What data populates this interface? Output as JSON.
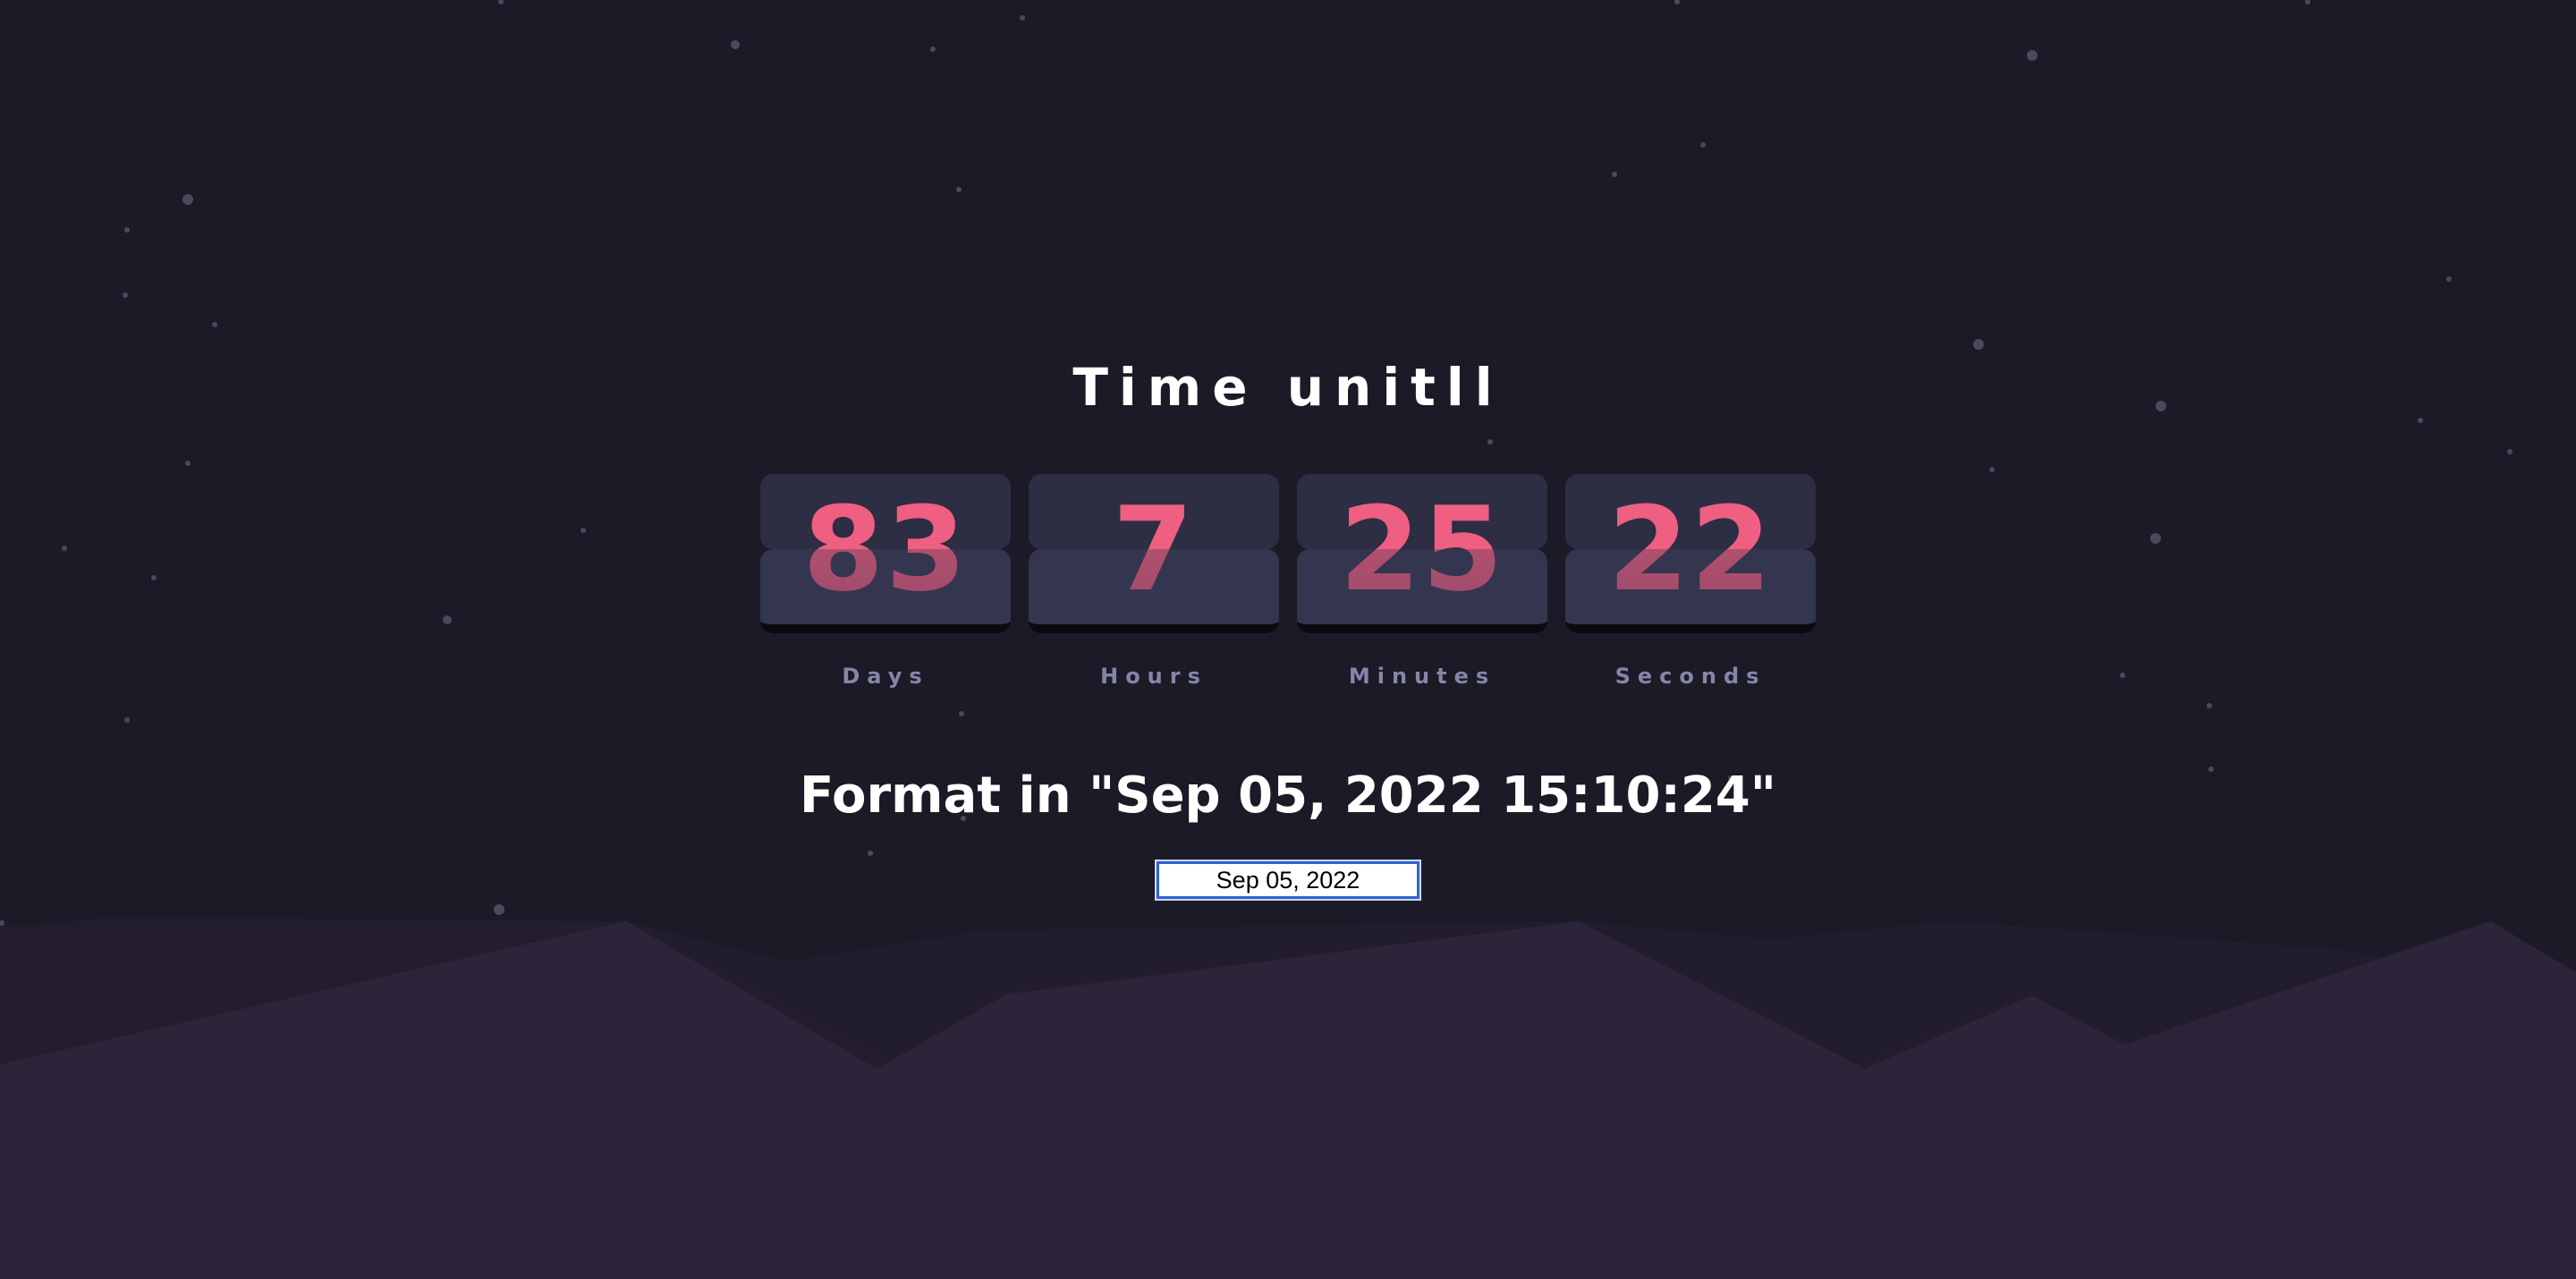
{
  "title": "Time unitll",
  "countdown": [
    {
      "value": "83",
      "label": "Days"
    },
    {
      "value": "7",
      "label": "Hours"
    },
    {
      "value": "25",
      "label": "Minutes"
    },
    {
      "value": "22",
      "label": "Seconds"
    }
  ],
  "format_hint": "Format in \"Sep 05, 2022 15:10:24\"",
  "date_input": {
    "value": "Sep 05, 2022"
  },
  "colors": {
    "background": "#1b1a26",
    "digit": "#f5587c",
    "card": "#2d2d44",
    "label": "#8486a9",
    "hills_back": "#241f2f",
    "hills_front": "#2e2439"
  }
}
